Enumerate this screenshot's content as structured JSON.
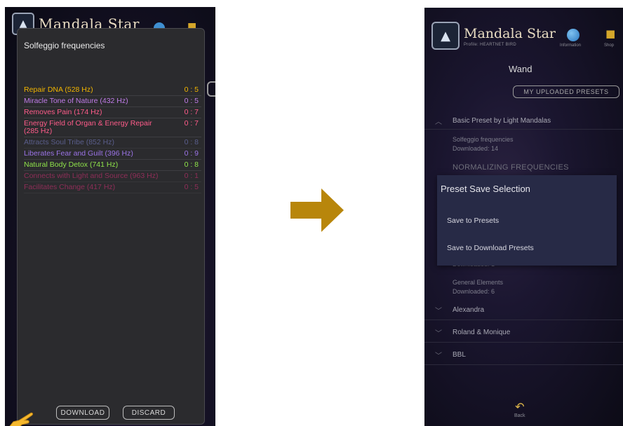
{
  "left_screen": {
    "background_app": {
      "title": "Mandala Star"
    },
    "dialog": {
      "title": "Solfeggio frequencies",
      "items": [
        {
          "label": "Repair DNA (528 Hz)",
          "count": "0 : 5",
          "color": "#f0b400"
        },
        {
          "label": "Miracle Tone of Nature (432 Hz)",
          "count": "0 : 5",
          "color": "#c07ce8"
        },
        {
          "label": "Removes Pain (174 Hz)",
          "count": "0 : 7",
          "color": "#ff5c8a"
        },
        {
          "label": "Energy Field of Organ & Energy Repair (285 Hz)",
          "count": "0 : 7",
          "color": "#ff5c8a"
        },
        {
          "label": "Attracts Soul Tribe (852 Hz)",
          "count": "0 : 8",
          "color": "#7f86d6"
        },
        {
          "label": "Liberates Fear and Guilt (396 Hz)",
          "count": "0 : 9",
          "color": "#9b73e6"
        },
        {
          "label": "Natural Body Detox (741 Hz)",
          "count": "0 : 8",
          "color": "#8fe34a"
        },
        {
          "label": "Connects with Light and Source (963 Hz)",
          "count": "0 : 1",
          "color": "#e0307a"
        },
        {
          "label": "Facilitates Change (417 Hz)",
          "count": "0 : 5",
          "color": "#e0307a"
        }
      ],
      "download_label": "DOWNLOAD",
      "discard_label": "DISCARD"
    }
  },
  "arrow_color": "#b8860b",
  "right_screen": {
    "app_title": "Mandala Star",
    "profile": "Profile: HEARTNET BIRD",
    "info_label": "Information",
    "shop_label": "Shop",
    "section_title": "Wand",
    "uploaded_button": "MY UPLOADED PRESETS",
    "groups": [
      {
        "label": "Basic Preset by Light Mandalas",
        "expanded": true
      },
      {
        "label": "Alexandra"
      },
      {
        "label": "Roland & Monique"
      },
      {
        "label": "BBL"
      }
    ],
    "presets": [
      {
        "name": "Solfeggio frequencies",
        "downloaded": "Downloaded: 14"
      },
      {
        "name": "NORMALIZING FREQUENCIES"
      },
      {
        "name": "",
        "downloaded": "Downloaded: 1"
      },
      {
        "name": "General Elements",
        "downloaded": "Downloaded: 6"
      }
    ],
    "sheet": {
      "title": "Preset Save Selection",
      "options": [
        "Save to Presets",
        "Save to Download Presets"
      ]
    },
    "back_label": "Back"
  }
}
